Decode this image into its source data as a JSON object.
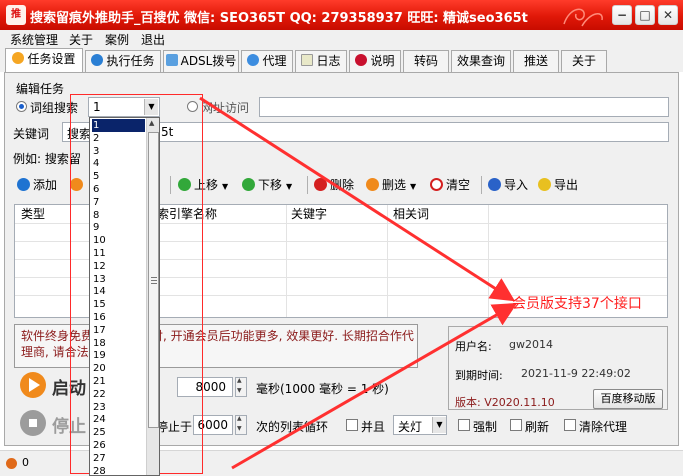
{
  "window": {
    "title": "搜索留痕外推助手_百搜优 微信: SEO365T QQ: 279358937 旺旺: 精诚seo365t",
    "icon_label": "推",
    "controls": {
      "minimize": "−",
      "maximize": "□",
      "close": "✕"
    }
  },
  "menu": [
    "系统管理",
    "关于",
    "案例",
    "退出"
  ],
  "tabs": [
    "任务设置",
    "执行任务",
    "ADSL拨号",
    "代理",
    "日志",
    "说明",
    "转码",
    "效果查询",
    "推送",
    "关于"
  ],
  "task": {
    "group_label": "编辑任务",
    "radio_keyword_label": "词组搜索",
    "combo_value": "1",
    "radio_url_label": "网址访问",
    "url_value": "",
    "keyword_label": "关键词",
    "keyword_value_left": "搜索",
    "keyword_value_right": "5t",
    "example_label": "例如: 搜索留"
  },
  "toolbar": {
    "add": "添加",
    "up": "上移",
    "down": "下移",
    "delete": "删除",
    "filter_delete": "删选",
    "clear": "清空",
    "import": "导入",
    "export": "导出"
  },
  "grid": {
    "columns": [
      "类型",
      "索引擎名称",
      "关键字",
      "相关词"
    ]
  },
  "notice": {
    "line1": "软件终身免费",
    "line1_tail": "付, 开通会员后功能更多, 效果更好. 长期招合作代",
    "line2": "理商, 请合法"
  },
  "controls": {
    "start_label": "启动",
    "stop_label": "停止",
    "interval_value": "8000",
    "interval_unit": "毫秒(1000 毫秒 = 1 秒)",
    "stop_at_label": "停止于",
    "stop_at_value": "6000",
    "stop_at_suffix": "次的列表循环",
    "and_label": "并且",
    "and_select": "关灯",
    "force_label": "强制",
    "refresh_label": "刷新",
    "clear_proxy_label": "清除代理"
  },
  "member": {
    "user_label": "用户名:",
    "user_value": "gw2014",
    "expire_label": "到期时间:",
    "expire_value": "2021-11-9 22:49:02",
    "version_label": "版本: V2020.11.10",
    "baidu_mobile_btn": "百度移动版"
  },
  "status": {
    "count": "0"
  },
  "dropdown": {
    "options": [
      "1",
      "2",
      "3",
      "4",
      "5",
      "6",
      "7",
      "8",
      "9",
      "10",
      "11",
      "12",
      "13",
      "14",
      "15",
      "16",
      "17",
      "18",
      "19",
      "20",
      "21",
      "22",
      "23",
      "24",
      "25",
      "26",
      "27",
      "28"
    ],
    "selected": "1"
  },
  "annotation": {
    "text": "会员版支持37个接口",
    "color": "#ff2020"
  }
}
